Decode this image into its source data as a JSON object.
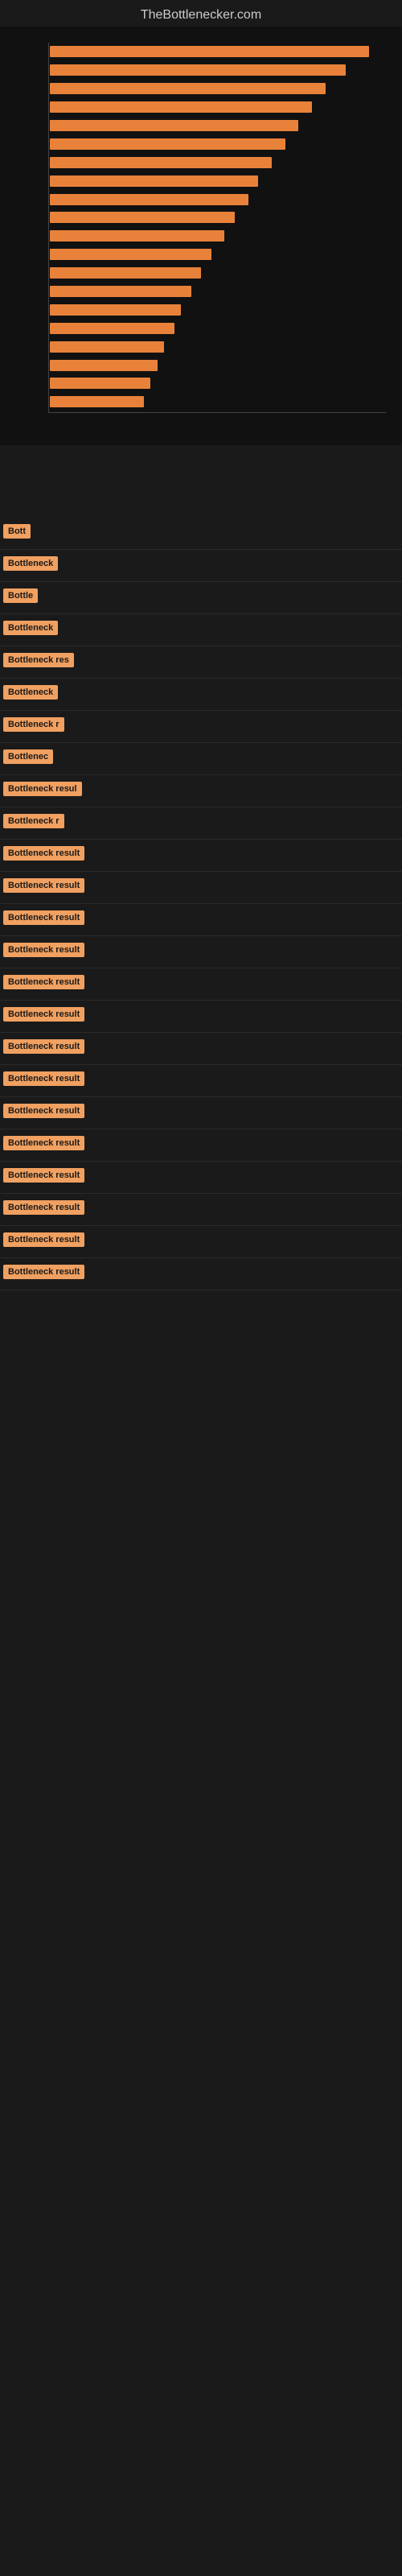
{
  "site": {
    "title": "TheBottlenecker.com"
  },
  "chart": {
    "bars": [
      {
        "width": 95
      },
      {
        "width": 88
      },
      {
        "width": 82
      },
      {
        "width": 78
      },
      {
        "width": 74
      },
      {
        "width": 70
      },
      {
        "width": 66
      },
      {
        "width": 62
      },
      {
        "width": 59
      },
      {
        "width": 55
      },
      {
        "width": 52
      },
      {
        "width": 48
      },
      {
        "width": 45
      },
      {
        "width": 42
      },
      {
        "width": 39
      },
      {
        "width": 37
      },
      {
        "width": 34
      },
      {
        "width": 32
      },
      {
        "width": 30
      },
      {
        "width": 28
      }
    ]
  },
  "results": [
    {
      "label": "Bott",
      "size": "small"
    },
    {
      "label": "Bottleneck",
      "size": "medium"
    },
    {
      "label": "Bottle",
      "size": "small"
    },
    {
      "label": "Bottleneck",
      "size": "medium"
    },
    {
      "label": "Bottleneck res",
      "size": "large"
    },
    {
      "label": "Bottleneck",
      "size": "medium"
    },
    {
      "label": "Bottleneck r",
      "size": "large"
    },
    {
      "label": "Bottlenec",
      "size": "medium"
    },
    {
      "label": "Bottleneck resul",
      "size": "large"
    },
    {
      "label": "Bottleneck r",
      "size": "large"
    },
    {
      "label": "Bottleneck result",
      "size": "full"
    },
    {
      "label": "Bottleneck result",
      "size": "full"
    },
    {
      "label": "Bottleneck result",
      "size": "full"
    },
    {
      "label": "Bottleneck result",
      "size": "full"
    },
    {
      "label": "Bottleneck result",
      "size": "full"
    },
    {
      "label": "Bottleneck result",
      "size": "full"
    },
    {
      "label": "Bottleneck result",
      "size": "full"
    },
    {
      "label": "Bottleneck result",
      "size": "full"
    },
    {
      "label": "Bottleneck result",
      "size": "full"
    },
    {
      "label": "Bottleneck result",
      "size": "full"
    },
    {
      "label": "Bottleneck result",
      "size": "full"
    },
    {
      "label": "Bottleneck result",
      "size": "full"
    },
    {
      "label": "Bottleneck result",
      "size": "full"
    },
    {
      "label": "Bottleneck result",
      "size": "full"
    }
  ]
}
